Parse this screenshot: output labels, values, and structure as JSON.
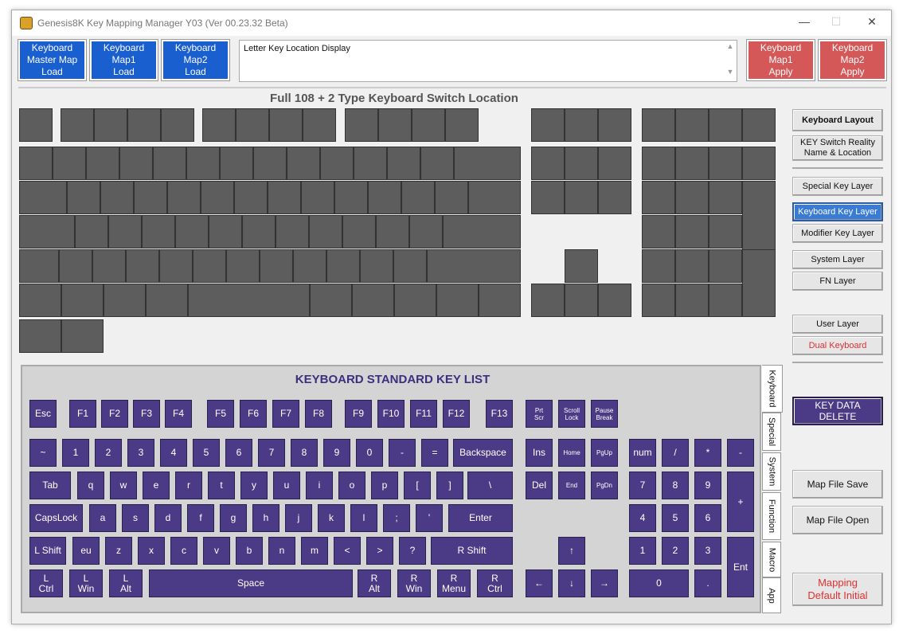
{
  "window": {
    "title": "Genesis8K Key Mapping Manager Y03 (Ver 00.23.32 Beta)",
    "minimize": "—",
    "maximize": "☐",
    "close": "✕"
  },
  "toolbar": {
    "master_load": "Keyboard\nMaster Map\nLoad",
    "map1_load": "Keyboard\nMap1\nLoad",
    "map2_load": "Keyboard\nMap2\nLoad",
    "map1_apply": "Keyboard\nMap1\nApply",
    "map2_apply": "Keyboard\nMap2\nApply"
  },
  "display": {
    "text": "Letter Key Location Display",
    "scroll_up": "▲",
    "scroll_down": "▼"
  },
  "layout": {
    "title": "Full 108 + 2 Type Keyboard Switch Location"
  },
  "side": {
    "keyboard_layout": "Keyboard Layout",
    "switch_reality": "KEY Switch Reality\nName & Location",
    "special_layer": "Special Key Layer",
    "keyboard_layer": "Keyboard Key Layer",
    "modifier_layer": "Modifier Key Layer",
    "system_layer": "System Layer",
    "fn_layer": "FN Layer",
    "user_layer": "User Layer",
    "dual_keyboard": "Dual Keyboard",
    "key_data_delete": "KEY DATA\nDELETE",
    "map_save": "Map File Save",
    "map_open": "Map File Open",
    "mapping_default": "Mapping\nDefault Initial"
  },
  "panel": {
    "title": "KEYBOARD STANDARD KEY LIST",
    "tabs": [
      "Keyboard",
      "Special",
      "System",
      "Function",
      "Macro",
      "App"
    ],
    "keys": {
      "esc": "Esc",
      "f1": "F1",
      "f2": "F2",
      "f3": "F3",
      "f4": "F4",
      "f5": "F5",
      "f6": "F6",
      "f7": "F7",
      "f8": "F8",
      "f9": "F9",
      "f10": "F10",
      "f11": "F11",
      "f12": "F12",
      "f13": "F13",
      "prtscr": "Prt\nScr",
      "scroll": "Scroll\nLock",
      "pause": "Pause\nBreak",
      "tilde": "~",
      "n1": "1",
      "n2": "2",
      "n3": "3",
      "n4": "4",
      "n5": "5",
      "n6": "6",
      "n7": "7",
      "n8": "8",
      "n9": "9",
      "n0": "0",
      "minus": "-",
      "equal": "=",
      "backspace": "Backspace",
      "ins": "Ins",
      "home": "Home",
      "pgup": "PgUp",
      "num": "num",
      "kdiv": "/",
      "kmul": "*",
      "ksub": "-",
      "tab": "Tab",
      "q": "q",
      "w": "w",
      "e": "e",
      "r": "r",
      "t": "t",
      "y": "y",
      "u": "u",
      "i": "i",
      "o": "o",
      "p": "p",
      "lbr": "[",
      "rbr": "]",
      "bslash": "\\",
      "del": "Del",
      "end": "End",
      "pgdn": "PgDn",
      "k7": "7",
      "k8": "8",
      "k9": "9",
      "kadd": "+",
      "caps": "CapsLock",
      "a": "a",
      "s": "s",
      "d": "d",
      "f": "f",
      "g": "g",
      "h": "h",
      "j": "j",
      "k": "k",
      "l": "l",
      "semi": ";",
      "quote": "'",
      "enter": "Enter",
      "k4": "4",
      "k5": "5",
      "k6": "6",
      "lshift": "L Shift",
      "eu": "eu",
      "z": "z",
      "x": "x",
      "c": "c",
      "v": "v",
      "b": "b",
      "n": "n",
      "m": "m",
      "lt": "<",
      "gt": ">",
      "qm": "?",
      "rshift": "R Shift",
      "up": "↑",
      "k1": "1",
      "k2": "2",
      "k3": "3",
      "kent": "Ent",
      "lctrl": "L\nCtrl",
      "lwin": "L\nWin",
      "lalt": "L\nAlt",
      "space": "Space",
      "ralt": "R\nAlt",
      "rwin": "R\nWin",
      "menu": "R\nMenu",
      "rctrl": "R\nCtrl",
      "left": "←",
      "down": "↓",
      "right": "→",
      "k0": "0",
      "kdot": "."
    }
  }
}
